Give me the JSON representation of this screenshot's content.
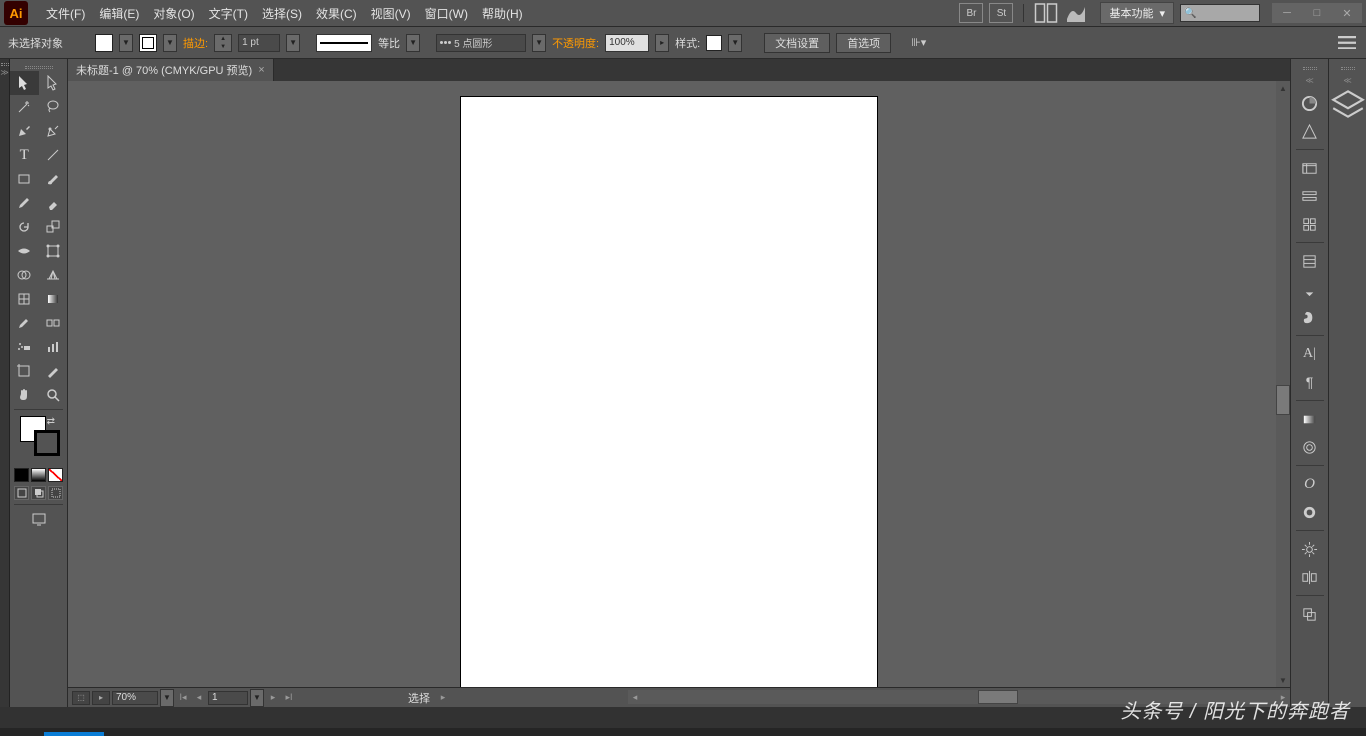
{
  "app": {
    "logo_text": "Ai"
  },
  "menu": [
    "文件(F)",
    "编辑(E)",
    "对象(O)",
    "文字(T)",
    "选择(S)",
    "效果(C)",
    "视图(V)",
    "窗口(W)",
    "帮助(H)"
  ],
  "top_icons": [
    "Br",
    "St"
  ],
  "workspace": {
    "label": "基本功能",
    "arrow": "▾"
  },
  "search": {
    "icon": "🔍"
  },
  "options": {
    "selection": "未选择对象",
    "stroke_label": "描边:",
    "stroke_value": "1 pt",
    "uniform": "等比",
    "profile": "5 点圆形",
    "opacity_label": "不透明度:",
    "opacity_value": "100%",
    "style_label": "样式:",
    "doc_setup": "文档设置",
    "prefs": "首选项"
  },
  "document": {
    "tab": "未标题-1 @ 70% (CMYK/GPU 预览)"
  },
  "status": {
    "zoom": "70%",
    "page": "1",
    "tool": "选择"
  },
  "watermark": "头条号 / 阳光下的奔跑者",
  "tools": [
    [
      "selection",
      "direct-selection"
    ],
    [
      "magic-wand",
      "lasso"
    ],
    [
      "pen",
      "curvature"
    ],
    [
      "type",
      "line"
    ],
    [
      "rectangle",
      "paintbrush"
    ],
    [
      "pencil",
      "eraser"
    ],
    [
      "rotate",
      "scale"
    ],
    [
      "width",
      "free-transform"
    ],
    [
      "shape-builder",
      "perspective"
    ],
    [
      "mesh",
      "gradient"
    ],
    [
      "eyedropper",
      "blend"
    ],
    [
      "symbol-sprayer",
      "column-graph"
    ],
    [
      "artboard",
      "slice"
    ],
    [
      "hand",
      "zoom"
    ]
  ],
  "right_panel_icons": [
    "color",
    "color-guide",
    "swatches",
    "brushes",
    "symbols",
    "stroke",
    "gradient",
    "transparency",
    "appearance",
    "graphic-styles",
    "layers",
    "artboards",
    "links",
    "cc-libraries",
    "align",
    "pathfinder",
    "transform"
  ]
}
